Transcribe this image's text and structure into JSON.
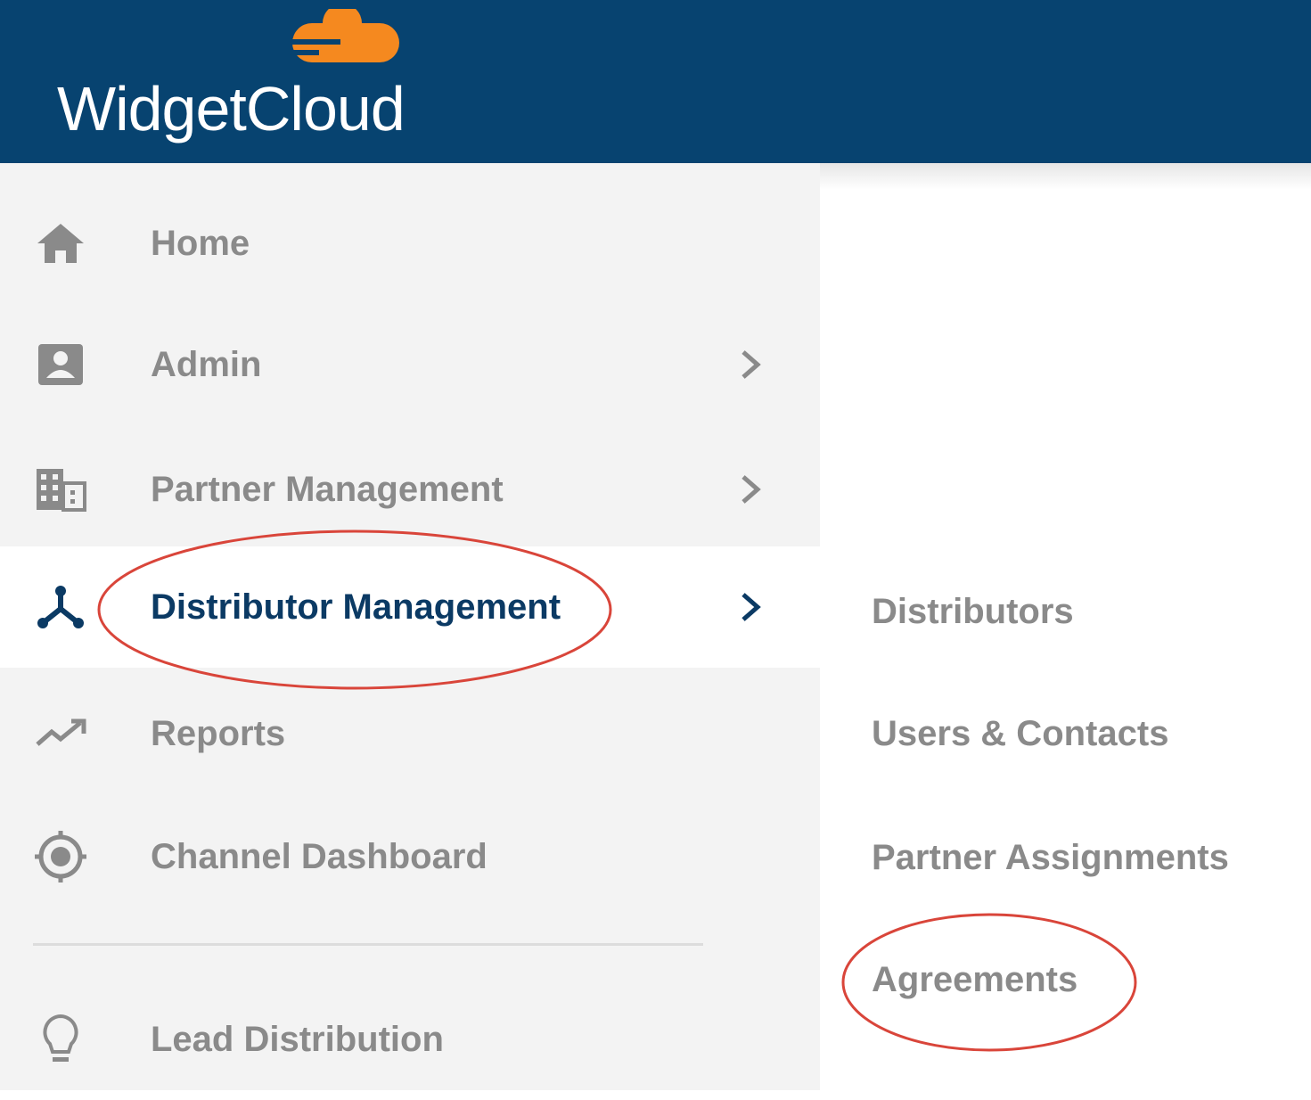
{
  "header": {
    "brand": "WidgetCloud",
    "background_color": "#074370",
    "logo_color": "#F5891F",
    "logo_icon": "cloud-icon"
  },
  "sidebar": {
    "items": [
      {
        "label": "Home",
        "icon": "home-icon",
        "has_submenu": false
      },
      {
        "label": "Admin",
        "icon": "contact-card-icon",
        "has_submenu": true
      },
      {
        "label": "Partner Management",
        "icon": "building-icon",
        "has_submenu": true
      },
      {
        "label": "Distributor Management",
        "icon": "distribution-network-icon",
        "has_submenu": true,
        "active": true
      },
      {
        "label": "Reports",
        "icon": "trending-up-icon",
        "has_submenu": false
      },
      {
        "label": "Channel Dashboard",
        "icon": "target-icon",
        "has_submenu": false
      },
      {
        "label": "Lead Distribution",
        "icon": "lightbulb-icon",
        "has_submenu": false
      }
    ]
  },
  "submenu": {
    "items": [
      {
        "label": "Distributors"
      },
      {
        "label": "Users & Contacts"
      },
      {
        "label": "Partner Assignments"
      },
      {
        "label": "Agreements"
      }
    ]
  },
  "colors": {
    "active_text": "#0B3A64",
    "inactive_text": "#8A8A8A",
    "sidebar_bg": "#F3F3F3",
    "annotation_red": "#D9453A"
  }
}
